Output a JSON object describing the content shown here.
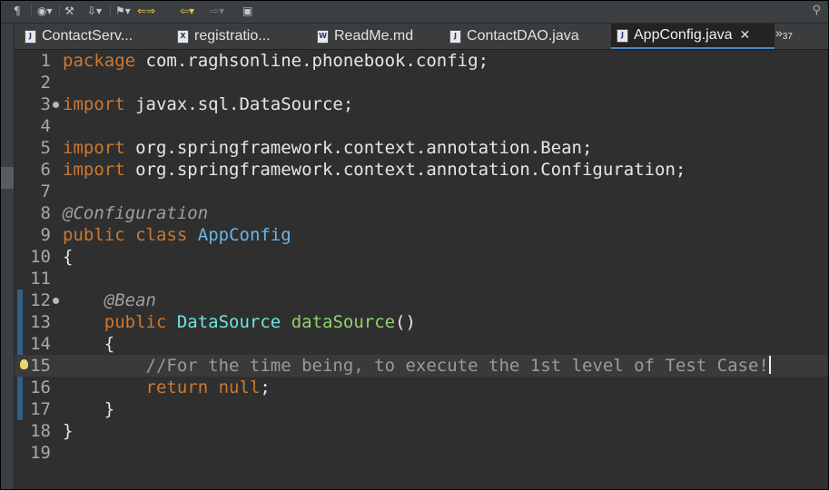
{
  "toolbar": {
    "icons": [
      "pilcrow-icon",
      "globe-icon",
      "tool-icon",
      "import-icon",
      "history-icon",
      "back-forward-icon",
      "navigate-back-icon",
      "navigate-forward-icon",
      "new-window-icon",
      "search-icon"
    ]
  },
  "tabs": [
    {
      "label": "ContactServ...",
      "icon": "J"
    },
    {
      "label": "registratio...",
      "icon": "X"
    },
    {
      "label": "ReadMe.md",
      "icon": "W"
    },
    {
      "label": "ContactDAO.java",
      "icon": "J"
    },
    {
      "label": "AppConfig.java",
      "icon": "J",
      "active": true
    }
  ],
  "overflow": {
    "symbol": "»",
    "count": "37"
  },
  "lines": [
    {
      "n": "1",
      "t": [
        [
          "kw",
          "package"
        ],
        [
          "p",
          " com.raghsonline.phonebook.config;"
        ]
      ]
    },
    {
      "n": "2",
      "t": []
    },
    {
      "n": "3",
      "t": [
        [
          "kw",
          "import"
        ],
        [
          "p",
          " javax.sql.DataSource;"
        ]
      ],
      "fold": true
    },
    {
      "n": "4",
      "t": []
    },
    {
      "n": "5",
      "t": [
        [
          "kw",
          "import"
        ],
        [
          "p",
          " org.springframework.context.annotation.Bean;"
        ]
      ]
    },
    {
      "n": "6",
      "t": [
        [
          "kw",
          "import"
        ],
        [
          "p",
          " org.springframework.context.annotation.Configuration;"
        ]
      ]
    },
    {
      "n": "7",
      "t": []
    },
    {
      "n": "8",
      "t": [
        [
          "ann",
          "@Configuration"
        ]
      ]
    },
    {
      "n": "9",
      "t": [
        [
          "kw",
          "public"
        ],
        [
          "p",
          " "
        ],
        [
          "kw",
          "class"
        ],
        [
          "p",
          " "
        ],
        [
          "cls",
          "AppConfig"
        ]
      ]
    },
    {
      "n": "10",
      "t": [
        [
          "p",
          "{"
        ]
      ]
    },
    {
      "n": "11",
      "t": []
    },
    {
      "n": "12",
      "t": [
        [
          "p",
          "    "
        ],
        [
          "ann",
          "@Bean"
        ]
      ],
      "fold": true
    },
    {
      "n": "13",
      "t": [
        [
          "p",
          "    "
        ],
        [
          "kw",
          "public"
        ],
        [
          "p",
          " "
        ],
        [
          "typ",
          "DataSource"
        ],
        [
          "p",
          " "
        ],
        [
          "mth",
          "dataSource"
        ],
        [
          "p",
          "()"
        ]
      ]
    },
    {
      "n": "14",
      "t": [
        [
          "p",
          "    {"
        ]
      ]
    },
    {
      "n": "15",
      "t": [
        [
          "p",
          "        "
        ],
        [
          "cmt",
          "//For the time being, to execute the 1st level of Test Case!"
        ]
      ],
      "current": true,
      "bulb": true
    },
    {
      "n": "16",
      "t": [
        [
          "p",
          "        "
        ],
        [
          "kw",
          "return"
        ],
        [
          "p",
          " "
        ],
        [
          "kw",
          "null"
        ],
        [
          "p",
          ";"
        ]
      ]
    },
    {
      "n": "17",
      "t": [
        [
          "p",
          "    }"
        ]
      ]
    },
    {
      "n": "18",
      "t": [
        [
          "p",
          "}"
        ]
      ]
    },
    {
      "n": "19",
      "t": []
    }
  ]
}
